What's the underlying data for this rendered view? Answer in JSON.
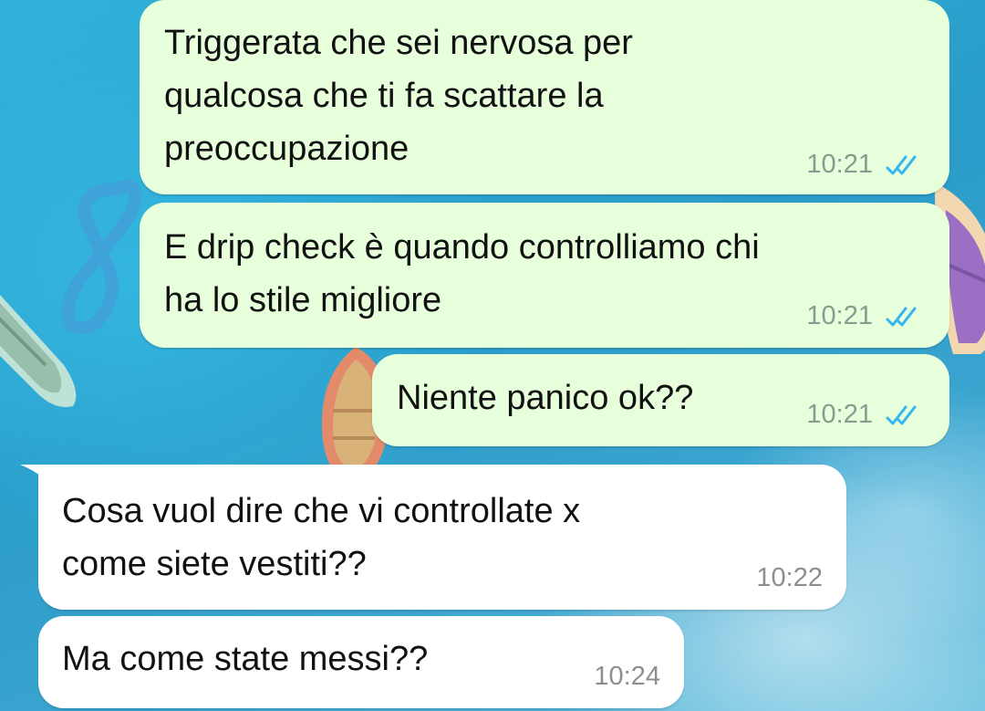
{
  "chat": {
    "messages": [
      {
        "direction": "outgoing",
        "text": "Triggerata che sei nervosa per\nqualcosa che ti fa scattare la\npreoccupazione",
        "time": "10:21",
        "status": "read-double-check-icon"
      },
      {
        "direction": "outgoing",
        "text": "E drip check è quando controlliamo chi\nha lo stile migliore",
        "time": "10:21",
        "status": "read-double-check-icon"
      },
      {
        "direction": "outgoing",
        "text": "Niente panico ok??",
        "time": "10:21",
        "status": "read-double-check-icon"
      },
      {
        "direction": "incoming",
        "text": "Cosa vuol dire che vi controllate x\ncome siete vestiti??",
        "time": "10:22"
      },
      {
        "direction": "incoming",
        "text": "Ma come state messi??",
        "time": "10:24"
      }
    ]
  },
  "colors": {
    "outgoing_bubble": "#e7ffdb",
    "incoming_bubble": "#ffffff",
    "read_tick": "#34b7f1",
    "wallpaper_water": "#2fb0da"
  }
}
